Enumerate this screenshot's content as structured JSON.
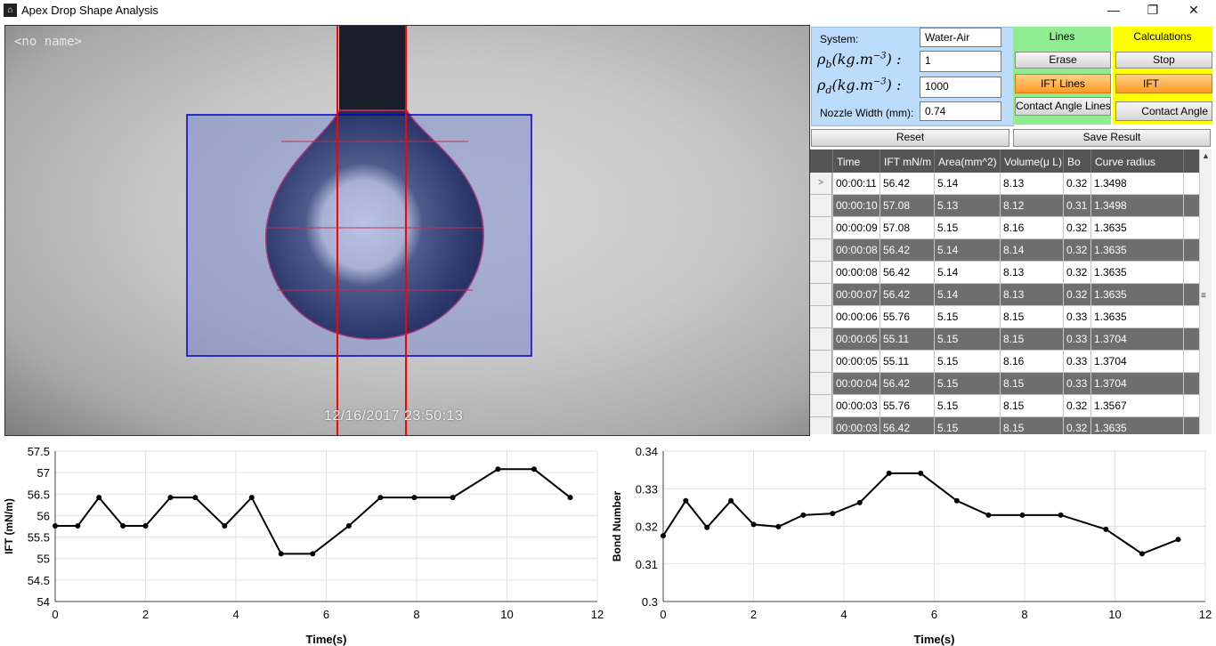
{
  "window": {
    "title": "Apex Drop Shape Analysis",
    "min_glyph": "—",
    "max_glyph": "❐",
    "close_glyph": "✕"
  },
  "camera": {
    "label": "<no name>",
    "timestamp": "12/16/2017   23:50:13",
    "line_color": "#ff0000",
    "roi_color": "#0000cc"
  },
  "params": {
    "system_label": "System:",
    "system_value": "Water-Air",
    "rho_b_value": "1",
    "rho_d_value": "1000",
    "nozzle_label": "Nozzle Width (mm):",
    "nozzle_value": "0.74"
  },
  "lines": {
    "title": "Lines",
    "erase": "Erase",
    "ift_lines": "IFT Lines",
    "contact_angle_lines": "Contact Angle Lines"
  },
  "calculations": {
    "title": "Calculations",
    "stop": "Stop",
    "ift": "IFT",
    "contact_angle": "Contact Angle"
  },
  "actions": {
    "reset": "Reset",
    "save_result": "Save Result"
  },
  "table": {
    "columns": [
      "Time",
      "IFT mN/m",
      "Area(mm^2)",
      "Volume(μ L)",
      "Bo",
      "Curve radius (mm)"
    ],
    "rows": [
      [
        "00:00:11",
        "56.42",
        "5.14",
        "8.13",
        "0.32",
        "1.3498"
      ],
      [
        "00:00:10",
        "57.08",
        "5.13",
        "8.12",
        "0.31",
        "1.3498"
      ],
      [
        "00:00:09",
        "57.08",
        "5.15",
        "8.16",
        "0.32",
        "1.3635"
      ],
      [
        "00:00:08",
        "56.42",
        "5.14",
        "8.14",
        "0.32",
        "1.3635"
      ],
      [
        "00:00:08",
        "56.42",
        "5.14",
        "8.13",
        "0.32",
        "1.3635"
      ],
      [
        "00:00:07",
        "56.42",
        "5.14",
        "8.13",
        "0.32",
        "1.3635"
      ],
      [
        "00:00:06",
        "55.76",
        "5.15",
        "8.15",
        "0.33",
        "1.3635"
      ],
      [
        "00:00:05",
        "55.11",
        "5.15",
        "8.15",
        "0.33",
        "1.3704"
      ],
      [
        "00:00:05",
        "55.11",
        "5.15",
        "8.16",
        "0.33",
        "1.3704"
      ],
      [
        "00:00:04",
        "56.42",
        "5.15",
        "8.15",
        "0.33",
        "1.3704"
      ],
      [
        "00:00:03",
        "55.76",
        "5.15",
        "8.15",
        "0.32",
        "1.3567"
      ],
      [
        "00:00:03",
        "56.42",
        "5.15",
        "8.15",
        "0.32",
        "1.3635"
      ]
    ],
    "current_row_marker": ">"
  },
  "chart_data": [
    {
      "type": "line",
      "xlabel": "Time(s)",
      "ylabel": "IFT (mN/m)",
      "xlim": [
        0,
        12
      ],
      "ylim": [
        54,
        57.5
      ],
      "xticks": [
        "0",
        "2",
        "4",
        "6",
        "8",
        "10",
        "12"
      ],
      "yticks": [
        "54",
        "54.5",
        "55",
        "55.5",
        "56",
        "56.5",
        "57",
        "57.5"
      ],
      "grid": true,
      "x": [
        0,
        0.5,
        0.97,
        1.5,
        2.0,
        2.55,
        3.1,
        3.75,
        4.35,
        5.0,
        5.7,
        6.5,
        7.2,
        7.95,
        8.8,
        9.8,
        10.6,
        11.4
      ],
      "y": [
        55.76,
        55.76,
        56.42,
        55.76,
        55.76,
        56.42,
        56.42,
        55.76,
        56.42,
        55.11,
        55.11,
        55.76,
        56.42,
        56.42,
        56.42,
        57.08,
        57.08,
        56.42
      ]
    },
    {
      "type": "line",
      "xlabel": "Time(s)",
      "ylabel": "Bond Number",
      "xlim": [
        0,
        12
      ],
      "ylim": [
        0.3,
        0.34
      ],
      "xticks": [
        "0",
        "2",
        "4",
        "6",
        "8",
        "10",
        "12"
      ],
      "yticks": [
        "0.3",
        "0.31",
        "0.32",
        "0.33",
        "0.34"
      ],
      "grid": true,
      "x": [
        0,
        0.5,
        0.97,
        1.5,
        2.0,
        2.55,
        3.1,
        3.75,
        4.35,
        5.0,
        5.7,
        6.5,
        7.2,
        7.95,
        8.8,
        9.8,
        10.6,
        11.4
      ],
      "y": [
        0.3175,
        0.3268,
        0.3197,
        0.3268,
        0.3205,
        0.3199,
        0.323,
        0.3234,
        0.3263,
        0.3341,
        0.3341,
        0.3268,
        0.323,
        0.323,
        0.323,
        0.3192,
        0.3127,
        0.3165
      ]
    }
  ]
}
